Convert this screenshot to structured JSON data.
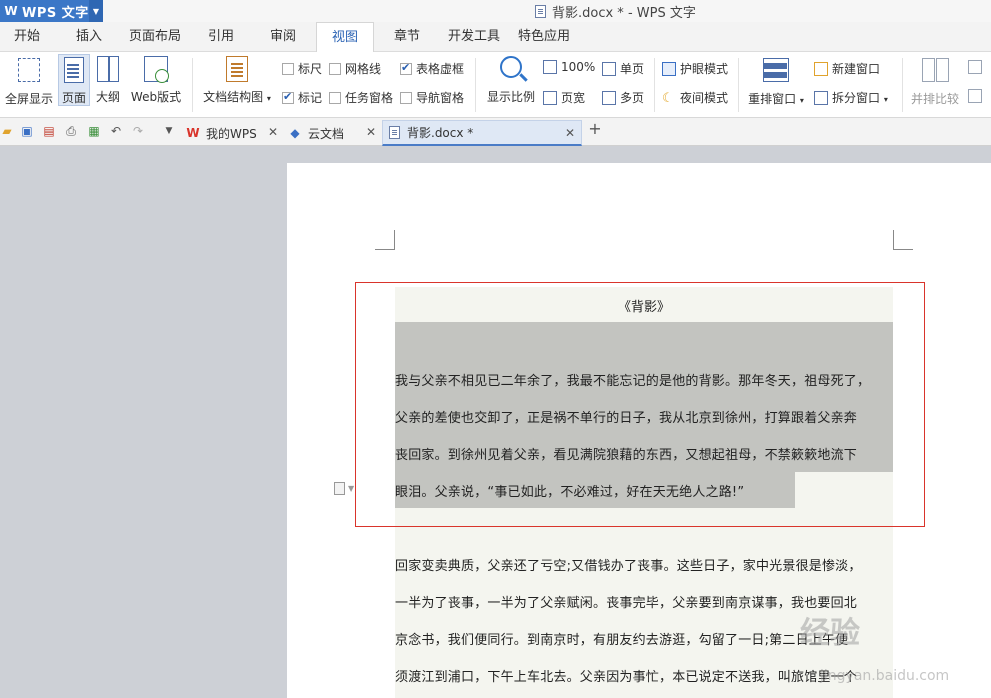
{
  "titlebar": {
    "app_name": "WPS 文字",
    "window_title": "背影.docx * - WPS 文字"
  },
  "menu": {
    "tabs": [
      "开始",
      "插入",
      "页面布局",
      "引用",
      "审阅",
      "视图",
      "章节",
      "开发工具",
      "特色应用"
    ],
    "active": "视图"
  },
  "ribbon": {
    "fullscreen": "全屏显示",
    "page": "页面",
    "outline": "大纲",
    "web": "Web版式",
    "doc_structure": "文档结构图",
    "ruler": "标尺",
    "gridlines": "网格线",
    "table_gridlines": "表格虚框",
    "marks": "标记",
    "task_pane": "任务窗格",
    "nav_pane": "导航窗格",
    "zoom": "显示比例",
    "zoom_100": "100%",
    "page_width": "页宽",
    "single_page": "单页",
    "multi_page": "多页",
    "eye_protect": "护眼模式",
    "night_mode": "夜间模式",
    "rearrange": "重排窗口",
    "new_window": "新建窗口",
    "split_window": "拆分窗口",
    "side_by_side": "并排比较",
    "checkboxes": {
      "ruler": false,
      "gridlines": false,
      "table_gridlines": true,
      "marks": true,
      "task_pane": false,
      "nav_pane": false
    }
  },
  "doctabs": [
    {
      "label": "我的WPS",
      "icon": "wps-logo-icon"
    },
    {
      "label": "云文档",
      "icon": "cloud-cube-icon"
    },
    {
      "label": "背影.docx *",
      "icon": "doc-icon"
    }
  ],
  "document": {
    "title": "《背影》",
    "selected_lines": [
      "我与父亲不相见已二年余了，我最不能忘记的是他的背影。那年冬天，祖母死了，",
      "父亲的差使也交卸了，正是祸不单行的日子，我从北京到徐州，打算跟着父亲奔",
      "丧回家。到徐州见着父亲，看见满院狼藉的东西，又想起祖母，不禁簌簌地流下",
      "眼泪。父亲说，“事已如此，不必难过，好在天无绝人之路!”"
    ],
    "lines": [
      "回家变卖典质，父亲还了亏空;又借钱办了丧事。这些日子，家中光景很是惨淡，",
      "一半为了丧事，一半为了父亲赋闲。丧事完毕，父亲要到南京谋事，我也要回北",
      "京念书，我们便同行。到南京时，有朋友约去游逛，勾留了一日;第二日上午便",
      "须渡江到浦口，下午上车北去。父亲因为事忙，本已说定不送我，叫旅馆里一个"
    ]
  },
  "watermark": {
    "main": "经验",
    "sub": "jingyan.baidu.com"
  }
}
